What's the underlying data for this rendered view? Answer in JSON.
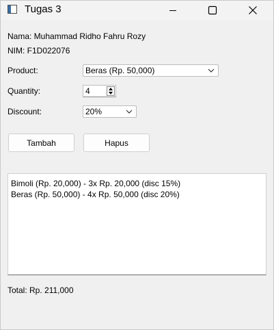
{
  "window": {
    "title": "Tugas 3"
  },
  "info": {
    "name_text": "Nama: Muhammad Ridho Fahru Rozy",
    "nim_text": "NIM: F1D022076"
  },
  "form": {
    "product_label": "Product:",
    "product_value": "Beras (Rp. 50,000)",
    "quantity_label": "Quantity:",
    "quantity_value": "4",
    "discount_label": "Discount:",
    "discount_value": "20%"
  },
  "buttons": {
    "tambah": "Tambah",
    "hapus": "Hapus"
  },
  "cart": {
    "items": [
      "Bimoli (Rp. 20,000) - 3x Rp. 20,000 (disc 15%)",
      "Beras (Rp. 50,000) - 4x Rp. 50,000 (disc 20%)"
    ]
  },
  "total_text": "Total: Rp. 211,000",
  "icons": {
    "app": "window-icon",
    "minimize": "minimize-icon",
    "maximize": "maximize-icon",
    "close": "close-icon",
    "dropdown": "chevron-down-icon",
    "spin": "spin-arrows-icon"
  }
}
